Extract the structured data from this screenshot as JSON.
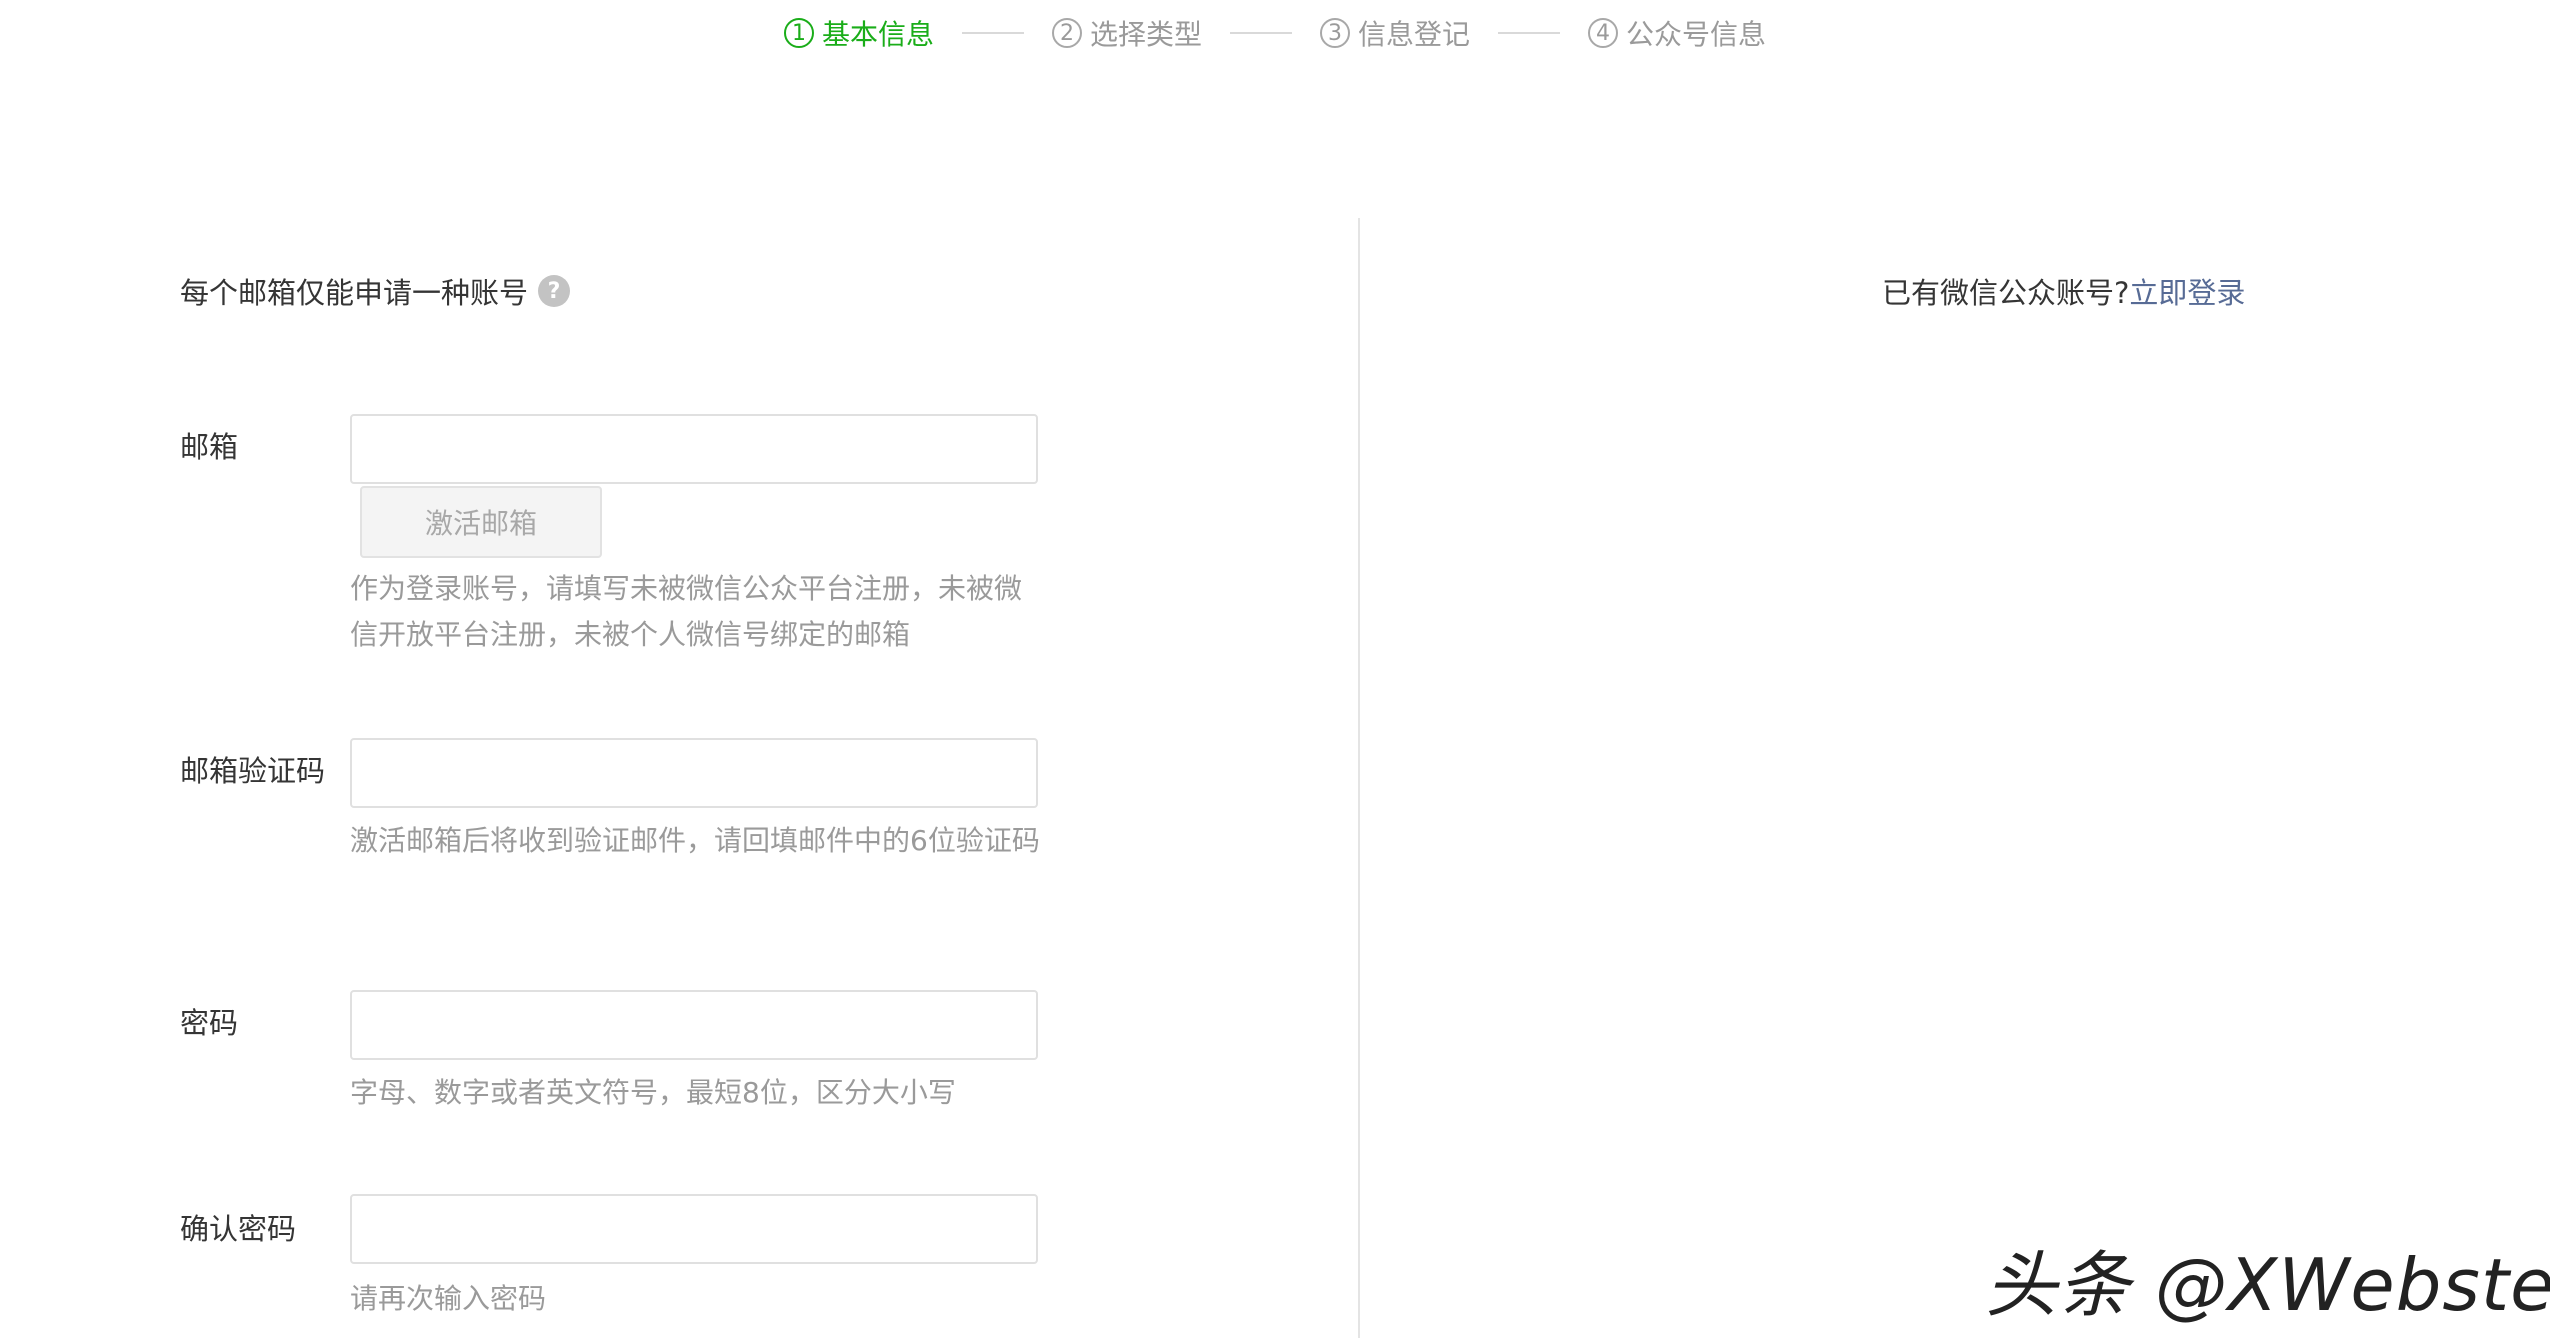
{
  "stepper": {
    "steps": [
      {
        "num": "1",
        "label": "基本信息",
        "active": true
      },
      {
        "num": "2",
        "label": "选择类型",
        "active": false
      },
      {
        "num": "3",
        "label": "信息登记",
        "active": false
      },
      {
        "num": "4",
        "label": "公众号信息",
        "active": false
      }
    ]
  },
  "form": {
    "notice": "每个邮箱仅能申请一种账号",
    "help_icon": "?",
    "email": {
      "label": "邮箱",
      "value": "",
      "placeholder": "",
      "activate_button": "激活邮箱",
      "hint": "作为登录账号，请填写未被微信公众平台注册，未被微信开放平台注册，未被个人微信号绑定的邮箱"
    },
    "email_code": {
      "label": "邮箱验证码",
      "value": "",
      "placeholder": "",
      "hint": "激活邮箱后将收到验证邮件，请回填邮件中的6位验证码"
    },
    "password": {
      "label": "密码",
      "value": "",
      "placeholder": "",
      "hint": "字母、数字或者英文符号，最短8位，区分大小写"
    },
    "confirm_password": {
      "label": "确认密码",
      "value": "",
      "placeholder": "",
      "hint": "请再次输入密码"
    }
  },
  "login": {
    "prompt": "已有微信公众账号?",
    "link": "立即登录"
  },
  "watermark": "头条 @XWebster",
  "colors": {
    "active_step": "#1aad19",
    "link": "#576b95",
    "hint_text": "#9a9a9a",
    "body_text": "#353535"
  }
}
